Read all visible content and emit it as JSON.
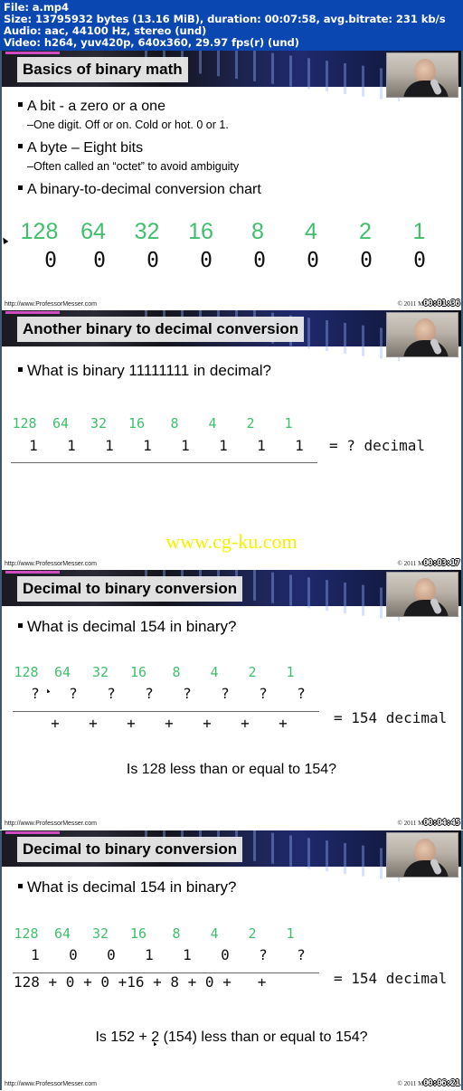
{
  "file_info": {
    "file": "File: a.mp4",
    "size": "Size: 13795932 bytes (13.16 MiB), duration: 00:07:58, avg.bitrate: 231 kb/s",
    "audio": "Audio: aac, 44100 Hz, stereo (und)",
    "video": "Video: h264, yuv420p, 640x360, 29.97 fps(r) (und)"
  },
  "footer": {
    "url": "http://www.ProfessorMesser.com",
    "copyright": "© 2011 Messe"
  },
  "watermark": "www.cg-ku.com",
  "place_values": [
    "128",
    "64",
    "32",
    "16",
    "8",
    "4",
    "2",
    "1"
  ],
  "frames": [
    {
      "title": "Basics of binary math",
      "timestamp": "00:01:36",
      "bullets": [
        {
          "level": 1,
          "text": "A bit - a zero or a one"
        },
        {
          "level": 2,
          "text": "–One digit. Off or on. Cold or hot. 0 or 1."
        },
        {
          "level": 1,
          "text": "A byte – Eight bits"
        },
        {
          "level": 2,
          "text": "–Often called an “octet” to avoid ambiguity"
        },
        {
          "level": 1,
          "text": "A binary-to-decimal conversion chart"
        }
      ],
      "bits": [
        "0",
        "0",
        "0",
        "0",
        "0",
        "0",
        "0",
        "0"
      ]
    },
    {
      "title": "Another binary to decimal conversion",
      "timestamp": "00:03:17",
      "question": "What is binary 11111111 in decimal?",
      "bits": [
        "1",
        "1",
        "1",
        "1",
        "1",
        "1",
        "1",
        "1"
      ],
      "result": "= ? decimal"
    },
    {
      "title": "Decimal to binary conversion",
      "timestamp": "00:04:45",
      "question": "What is decimal 154 in binary?",
      "bits": [
        "?",
        "?",
        "?",
        "?",
        "?",
        "?",
        "?",
        "?"
      ],
      "sum_terms": [
        "",
        "+",
        "+",
        "+",
        "+",
        "+",
        "+",
        "+"
      ],
      "result": "= 154 decimal",
      "prompt": "Is 128 less than or equal to 154?"
    },
    {
      "title": "Decimal to binary conversion",
      "timestamp": "00:06:21",
      "question": "What is decimal 154 in binary?",
      "bits": [
        "1",
        "0",
        "0",
        "1",
        "1",
        "0",
        "?",
        "?"
      ],
      "sum_line": "128 + 0 + 0 +16 + 8 + 0 +   +",
      "result": "= 154 decimal",
      "prompt": "Is 152 + 2 (154) less than or equal to 154?"
    }
  ]
}
